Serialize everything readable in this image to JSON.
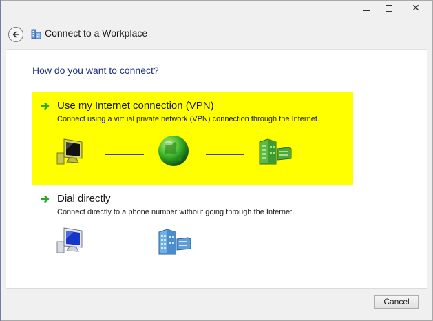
{
  "window": {
    "title": "Connect to a Workplace",
    "close_glyph": "✕"
  },
  "question": "How do you want to connect?",
  "options": [
    {
      "title": "Use my Internet connection (VPN)",
      "description": "Connect using a virtual private network (VPN) connection through the Internet.",
      "highlight_color": "#ffff00"
    },
    {
      "title": "Dial directly",
      "description": "Connect directly to a phone number without going through the Internet."
    }
  ],
  "footer": {
    "cancel_label": "Cancel"
  },
  "icons": [
    "back-arrow-icon",
    "workplace-icon",
    "green-arrow-icon",
    "computer-icon",
    "globe-icon",
    "server-building-icon"
  ],
  "colors": {
    "heading_blue": "#1e3287",
    "arrow_green": "#2aa82a",
    "globe_green": "#3cb52a"
  }
}
